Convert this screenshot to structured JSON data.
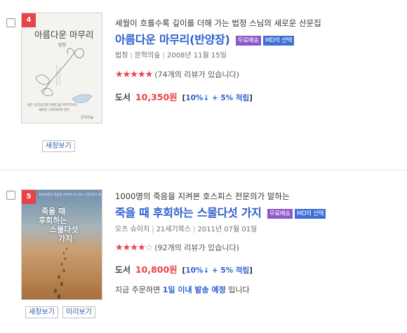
{
  "items": [
    {
      "rank": "4",
      "subtitle": "세월이 흐를수록 깊이를 더해 가는 법정 스님의 새로운 산문집",
      "title": "아름다운 마무리(반양장)",
      "badges": [
        "무료배송",
        "MD의 선택"
      ],
      "author": "법정",
      "publisher": "문학의숲",
      "date": "2008년 11월 15일",
      "stars_filled": "★★★★★",
      "stars_empty": "",
      "reviews": "(74개의 리뷰가 있습니다)",
      "price_label": "도서",
      "price": "10,350원",
      "discount_open": "[",
      "discount": "10%↓",
      "discount_plus": " + 5% 적립",
      "discount_close": "]",
      "cover": {
        "title": "아름다운 마무리",
        "author": "법정",
        "blurb": [
          "살은 순간순간의 아름다움 마무리이자",
          "새로운 시작이어야 한다"
        ],
        "publisher": "문학의숲"
      },
      "buttons": [
        "새창보기"
      ]
    },
    {
      "rank": "5",
      "subtitle": "1000명의 죽음을 지켜본 호스피스 전문의가 말하는",
      "title": "죽을 때 후회하는 스물다섯 가지",
      "badges": [
        "무료배송",
        "MD의 선택"
      ],
      "author": "오츠 슈이치",
      "publisher": "21세기북스",
      "date": "2011년 07월 01일",
      "stars_filled": "★★★★",
      "stars_empty": "☆",
      "reviews": "(92개의 리뷰가 있습니다)",
      "price_label": "도서",
      "price": "10,800원",
      "discount_open": "[",
      "discount": "10%↓",
      "discount_plus": " + 5% 적립",
      "discount_close": "]",
      "shipping_prefix": "지금 주문하면 ",
      "shipping_strong": "1일 이내 발송 예정",
      "shipping_suffix": " 입니다",
      "cover": {
        "title_lines": [
          "죽을 때",
          "후회하는",
          "스물다섯",
          "가지"
        ],
        "tagline": "1000명의 죽음을 지켜본 호스피스 전문의가 말하는"
      },
      "buttons": [
        "새창보기",
        "미리보기"
      ]
    }
  ],
  "colors": {
    "rank_bg": "#e8424a",
    "title": "#2d5fd0",
    "price": "#e8424a",
    "badge_ship": "#8b58c8",
    "badge_md": "#3e6fd6"
  }
}
